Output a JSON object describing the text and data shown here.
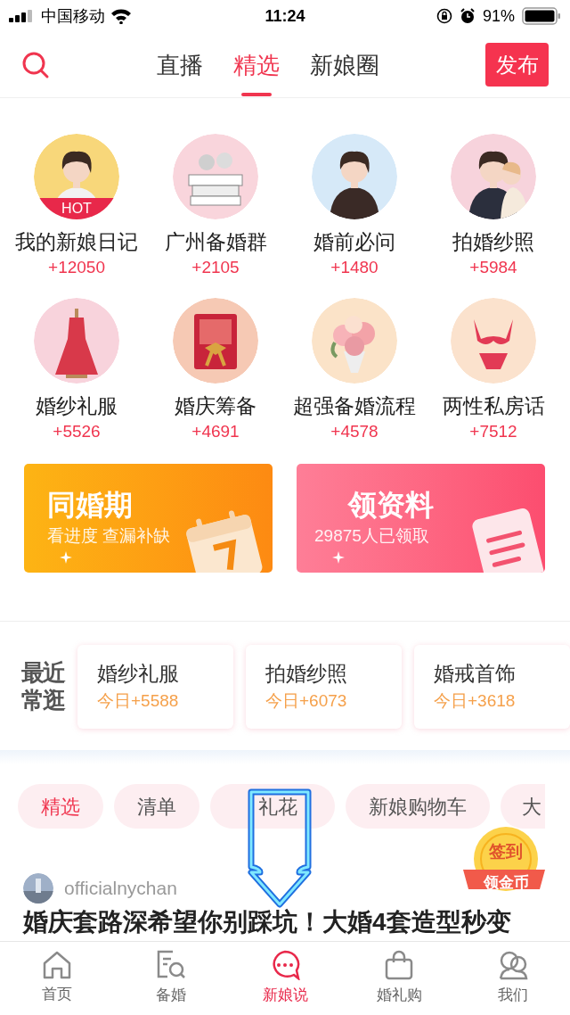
{
  "status_bar": {
    "carrier": "中国移动",
    "time": "11:24",
    "battery": "91%"
  },
  "header": {
    "tabs": [
      {
        "label": "直播",
        "selected": false
      },
      {
        "label": "精选",
        "selected": true
      },
      {
        "label": "新娘圈",
        "selected": false
      }
    ],
    "publish_button": "发布"
  },
  "categories": [
    {
      "name": "我的新娘日记",
      "count": "+12050",
      "badge": "HOT"
    },
    {
      "name": "广州备婚群",
      "count": "+2105"
    },
    {
      "name": "婚前必问",
      "count": "+1480"
    },
    {
      "name": "拍婚纱照",
      "count": "+5984"
    },
    {
      "name": "婚纱礼服",
      "count": "+5526"
    },
    {
      "name": "婚庆筹备",
      "count": "+4691"
    },
    {
      "name": "超强备婚流程",
      "count": "+4578"
    },
    {
      "name": "两性私房话",
      "count": "+7512"
    }
  ],
  "banners": [
    {
      "kind": "calendar",
      "title": "同婚期",
      "subtitle": "看进度 查漏补缺"
    },
    {
      "kind": "document",
      "title": "领资料",
      "subtitle": "29875人已领取"
    }
  ],
  "recent": {
    "heading": "最近常逛",
    "cards": [
      {
        "name": "婚纱礼服",
        "count": "今日+5588"
      },
      {
        "name": "拍婚纱照",
        "count": "今日+6073"
      },
      {
        "name": "婚戒首饰",
        "count": "今日+3618"
      }
    ]
  },
  "chips": [
    {
      "label": "精选",
      "selected": true
    },
    {
      "label": "清单",
      "selected": false
    },
    {
      "label": "礼花",
      "selected": false
    },
    {
      "label": "新娘购物车",
      "selected": false
    },
    {
      "label": "大",
      "selected": false
    }
  ],
  "post": {
    "author": "officialnychan",
    "title": "婚庆套路深希望你别踩坑！大婚4套造型秒变"
  },
  "signin_badge": {
    "top": "签到",
    "bottom": "领金币"
  },
  "nav": [
    {
      "label": "首页",
      "selected": false
    },
    {
      "label": "备婚",
      "selected": false
    },
    {
      "label": "新娘说",
      "selected": true
    },
    {
      "label": "婚礼购",
      "selected": false
    },
    {
      "label": "我们",
      "selected": false
    }
  ]
}
